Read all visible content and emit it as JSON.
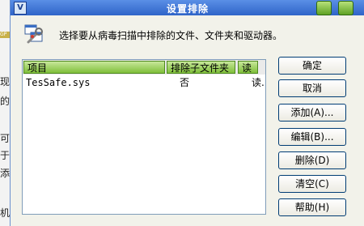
{
  "background_app": {
    "logo_text": "GP",
    "fragments": [
      "现",
      "的",
      "可",
      "于",
      "添",
      "机"
    ]
  },
  "window": {
    "title": "设置排除",
    "app_icon_letter": "V"
  },
  "header": {
    "description": "选择要从病毒扫描中排除的文件、文件夹和驱动器。"
  },
  "list": {
    "columns": [
      "项目",
      "排除子文件夹",
      "读"
    ],
    "rows": [
      {
        "item": "TesSafe.sys",
        "exclude_subfolders": "否",
        "read": "读..."
      }
    ]
  },
  "buttons": {
    "ok": "确定",
    "cancel": "取消",
    "add": "添加(A)...",
    "edit": "编辑(B)...",
    "delete": "删除(D)",
    "clear": "清空(C)",
    "help": "帮助(H)"
  },
  "colors": {
    "titlebar": "#2f64c8",
    "column_header": "#7fbf3a",
    "button_border": "#003c74",
    "dialog_bg": "#f2f2ea"
  }
}
